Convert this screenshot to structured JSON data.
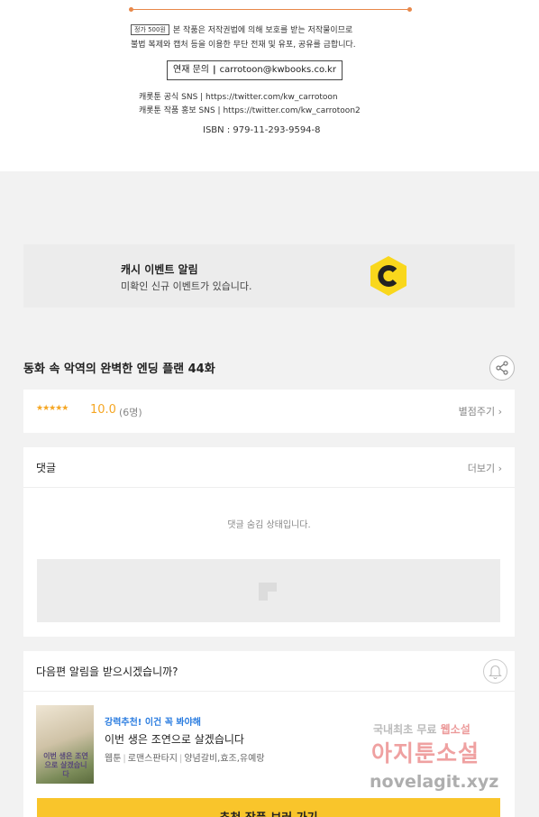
{
  "copyright": {
    "price_tag": "정가 500원",
    "notice_line1": "본 작품은 저작권법에 의해 보호를 받는 저작물이므로",
    "notice_line2": "불법 복제와 캡처 등을 이용한 무단 전재 및 유포, 공유를 금합니다.",
    "contact_label": "연재 문의",
    "contact_separator": "|",
    "contact_email": "carrotoon@kwbooks.co.kr",
    "sns_official": "캐롯툰 공식 SNS | https://twitter.com/kw_carrotoon",
    "sns_promo": "캐롯툰 작품 홍보 SNS | https://twitter.com/kw_carrotoon2",
    "isbn": "ISBN : 979-11-293-9594-8"
  },
  "cash_event": {
    "title": "캐시 이벤트 알림",
    "subtitle": "미확인 신규 이벤트가 있습니다.",
    "logo_icon": "cash-c-logo",
    "logo_color": "#f9d71c"
  },
  "episode": {
    "title": "동화 속 악역의 완벽한 엔딩 플랜 44화",
    "share_icon": "share-icon"
  },
  "rating": {
    "stars": "★★★★★",
    "score": "10.0",
    "count": "(6명)",
    "rate_link": "별점주기 ›"
  },
  "comments": {
    "label": "댓글",
    "more_link": "더보기 ›",
    "hidden_message": "댓글 숨김 상태입니다."
  },
  "next_alarm": {
    "question": "다음편 알림을 받으시겠습니까?",
    "bell_icon": "bell-icon"
  },
  "recommendation": {
    "tag": "강력추천! 이건 꼭 봐야해",
    "title": "이번 생은 조연으로 살겠습니다",
    "meta": [
      "웹툰",
      "로맨스판타지",
      "양념갈비,효조,유예랑"
    ],
    "thumb_text": "이번 생은 조연으로 살겠습니다",
    "button_label": "추천 작품 보러 가기",
    "button_color": "#f9c52b"
  },
  "watermark": {
    "line1_a": "국내최초 무료",
    "line1_b": "웹소설",
    "line2": "아지툰소설",
    "line3": "novelagit.xyz"
  }
}
